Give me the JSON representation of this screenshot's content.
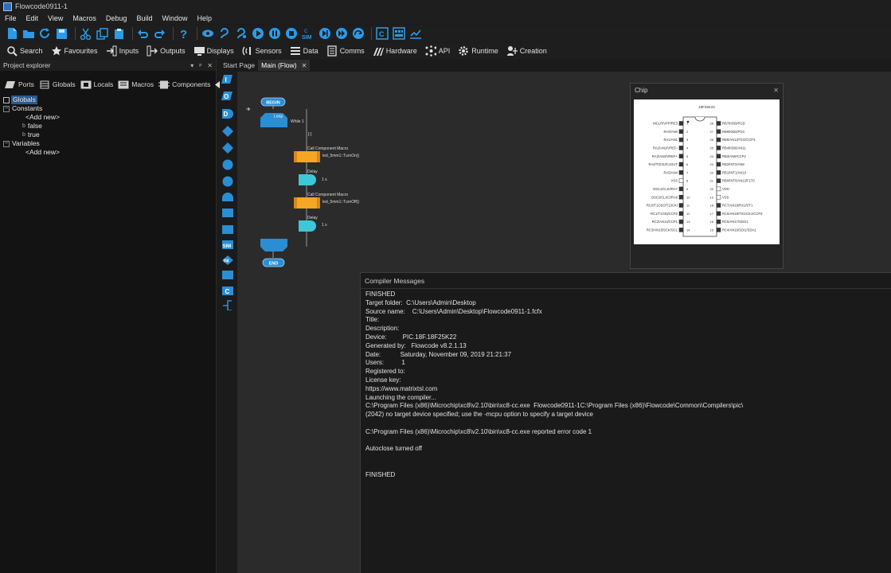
{
  "window": {
    "title": "Flowcode0911-1"
  },
  "menu": [
    "File",
    "Edit",
    "View",
    "Macros",
    "Debug",
    "Build",
    "Window",
    "Help"
  ],
  "components_toolbar": [
    {
      "label": "Search",
      "icon": "search-icon"
    },
    {
      "label": "Favourites",
      "icon": "star-icon"
    },
    {
      "label": "Inputs",
      "icon": "inputs-icon"
    },
    {
      "label": "Outputs",
      "icon": "outputs-icon"
    },
    {
      "label": "Displays",
      "icon": "display-icon"
    },
    {
      "label": "Sensors",
      "icon": "sensor-icon"
    },
    {
      "label": "Data",
      "icon": "data-icon"
    },
    {
      "label": "Comms",
      "icon": "comms-icon"
    },
    {
      "label": "Hardware",
      "icon": "hardware-icon"
    },
    {
      "label": "API",
      "icon": "api-icon"
    },
    {
      "label": "Runtime",
      "icon": "gear-icon"
    },
    {
      "label": "Creation",
      "icon": "creation-icon"
    }
  ],
  "explorer": {
    "title": "Project explorer",
    "header_buttons": [
      "▾",
      "ᵖ",
      "✕"
    ],
    "tabs": [
      {
        "label": "Ports"
      },
      {
        "label": "Globals"
      },
      {
        "label": "Locals"
      },
      {
        "label": "Macros"
      },
      {
        "label": "Components"
      }
    ],
    "tree": {
      "root": "Globals",
      "constants_label": "Constants",
      "constants": [
        "<Add new>",
        "false",
        "true"
      ],
      "variables_label": "Variables",
      "variables": [
        "<Add new>"
      ]
    }
  },
  "doc_tabs": [
    {
      "label": "Start Page",
      "active": false
    },
    {
      "label": "Main (Flow)",
      "active": true,
      "close": "✕"
    }
  ],
  "palette_labels": [
    "I",
    "O",
    "D",
    "C",
    "SIM",
    "INI"
  ],
  "flow": {
    "begin": "BEGIN",
    "loop": "Loop",
    "loop_cond": "While 1",
    "marker": "[-]",
    "call1_title": "Call Component Macro",
    "call1_text": "led_5mm1::TurnOn()",
    "delay1_title": "Delay",
    "delay1_text": "1 s",
    "call2_title": "Call Component Macro",
    "call2_text": "led_5mm1::TurnOff()",
    "delay2_title": "Delay",
    "delay2_text": "1 s",
    "end": "END"
  },
  "chip": {
    "title": "Chip",
    "close": "✕",
    "name": "18F25K22",
    "left_pins": [
      "MCLR/VPP/RE3",
      "RA0/AN0",
      "RA1/AN1",
      "RA2/AN2/VREF-",
      "RA3/AN3/VREF+",
      "RA4/T0CKI/C1OUT",
      "RA5/AN4",
      "VSS",
      "OSC1/CLKI/RA7",
      "OSC2/CLKO/RA6",
      "RC0/T1OSO/T13CKI",
      "RC1/T1OSI/CCP2",
      "RC2/AN14/CCP1",
      "RC3/AN15/SCK/SCL"
    ],
    "right_pins": [
      "RB7/KBI3/PGD",
      "RB6/KBI2/PGC",
      "RB5/AN13/T1G/CCP3",
      "RB4/KBI0/AN11",
      "RB3/AN9/CCP2",
      "RB2/INT2/AN8",
      "RB1/INT1/AN10",
      "RB0/INT0/AN12/FLT0",
      "VDD",
      "VSS",
      "RC7/AN19/RX1/DT1",
      "RC6/AN18/TX1/CK1/CCP3",
      "RC5/AN17/SDO1",
      "RC4/AN16/SDI1/SDA1"
    ]
  },
  "compiler": {
    "title": "Compiler Messages",
    "lines": [
      "FINISHED",
      "Target folder:  C:\\Users\\Admin\\Desktop",
      "Source name:    C:\\Users\\Admin\\Desktop\\Flowcode0911-1.fcfx",
      "Title:",
      "Description:",
      "Device:         PIC.18F.18F25K22",
      "Generated by:   Flowcode v8.2.1.13",
      "Date:           Saturday, November 09, 2019 21:21:37",
      "Users:          1",
      "Registered to:",
      "License key:",
      "https://www.matrixtsl.com",
      "Launching the compiler...",
      "C:\\Program Files (x86)\\Microchip\\xc8\\v2.10\\bin\\xc8-cc.exe  Flowcode0911-1C:\\Program Files (x86)\\Flowcode\\Common\\Compilers\\pic\\",
      "(2042) no target device specified; use the -mcpu option to specify a target device",
      "",
      "C:\\Program Files (x86)\\Microchip\\xc8\\v2.10\\bin\\xc8-cc.exe reported error code 1",
      "",
      "Autoclose turned off",
      "",
      "",
      "FINISHED"
    ]
  },
  "colors": {
    "accent_blue": "#1e88e5",
    "flow_blue": "#2a8ed4",
    "flow_orange": "#f5a623",
    "flow_cyan": "#3cc8d8"
  }
}
